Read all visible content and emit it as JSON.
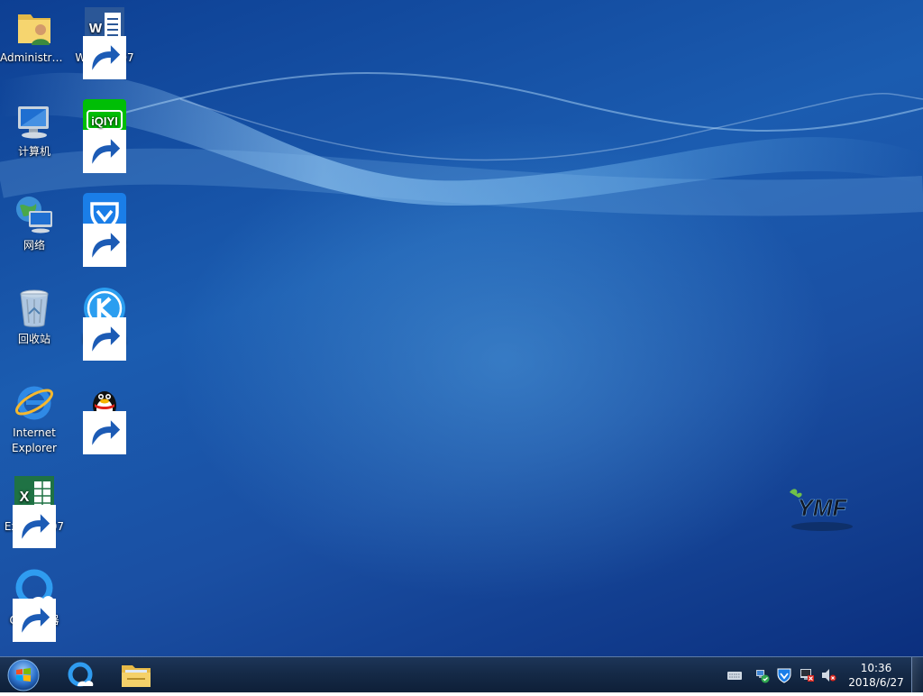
{
  "desktop": {
    "icons": [
      {
        "label": "Administra...",
        "icon": "user-folder-icon"
      },
      {
        "label": "Word 2007",
        "icon": "word-icon",
        "shortcut": true
      },
      {
        "label": "计算机",
        "icon": "computer-icon"
      },
      {
        "label": "爱奇艺",
        "icon": "iqiyi-icon",
        "shortcut": true,
        "logo_text": "iQIYI"
      },
      {
        "label": "网络",
        "icon": "network-icon"
      },
      {
        "label": "电脑管家",
        "icon": "tencent-pc-manager-icon",
        "shortcut": true
      },
      {
        "label": "回收站",
        "icon": "recycle-bin-icon"
      },
      {
        "label": "酷狗音乐",
        "icon": "kugou-music-icon",
        "shortcut": true
      },
      {
        "label": "Internet Explorer",
        "icon": "internet-explorer-icon"
      },
      {
        "label": "腾讯QQ",
        "icon": "qq-penguin-icon",
        "shortcut": true
      },
      {
        "label": "Excel 2007",
        "icon": "excel-icon",
        "shortcut": true
      },
      {
        "label": "QQ浏览器",
        "icon": "qq-browser-icon",
        "shortcut": true
      }
    ],
    "brand_logo_text": "YMF"
  },
  "taskbar": {
    "start_icon": "windows-orb-icon",
    "pinned": [
      {
        "icon": "qq-browser-icon"
      },
      {
        "icon": "file-explorer-icon"
      }
    ],
    "tray": [
      {
        "icon": "keyboard-icon"
      },
      {
        "icon": "network-status-icon"
      },
      {
        "icon": "security-shield-icon"
      },
      {
        "icon": "device-status-icon"
      },
      {
        "icon": "volume-muted-icon"
      }
    ],
    "clock": {
      "time": "10:36",
      "date": "2018/6/27"
    }
  },
  "colors": {
    "desktop_blue": "#1b5cb0",
    "taskbar": "#152a47",
    "iqiyi_green": "#00be06",
    "excel_green": "#1f7244",
    "word_blue": "#2b5797"
  }
}
